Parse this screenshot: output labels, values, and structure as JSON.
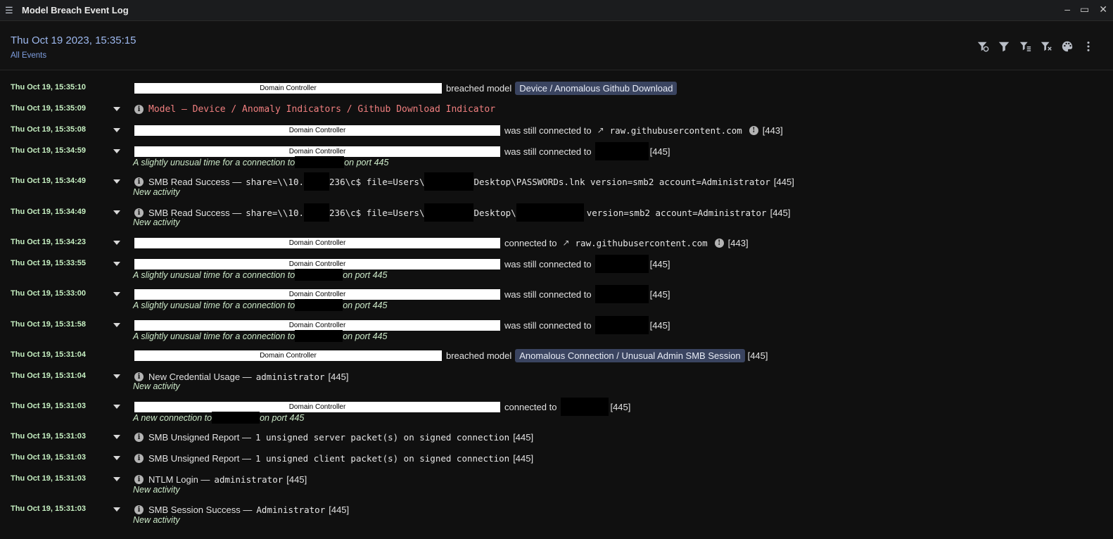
{
  "window": {
    "title": "Model Breach Event Log",
    "menu_icon": "list-icon",
    "controls": {
      "minimize": "–",
      "maximize": "▭",
      "close": "✕"
    }
  },
  "header": {
    "date": "Thu Oct 19 2023, 15:35:15",
    "subtitle": "All Events",
    "tools": [
      "filter-clear-icon",
      "filter-icon",
      "filter-list-icon",
      "filter-off-icon",
      "palette-icon",
      "more-vertical-icon"
    ]
  },
  "redacted_label": "Domain Controller",
  "events": [
    {
      "time": "Thu Oct 19, 15:35:10",
      "action": "breached model",
      "badge": "Device / Anomalous Github Download"
    },
    {
      "time": "Thu Oct 19, 15:35:09",
      "model": "Model — Device / Anomaly Indicators / Github Download Indicator"
    },
    {
      "time": "Thu Oct 19, 15:35:08",
      "action": "was still connected to",
      "host": "raw.githubusercontent.com",
      "port": "[443]"
    },
    {
      "time": "Thu Oct 19, 15:34:59",
      "action": "was still connected to",
      "port": "[445]",
      "note_a": "A slightly unusual time for a connection to",
      "note_b": "on port 445"
    },
    {
      "time": "Thu Oct 19, 15:34:49",
      "label": "SMB Read Success —",
      "detail_a": "share=\\\\10.",
      "detail_b": "236\\c$ file=Users\\",
      "detail_c": "Desktop\\PASSWORDs.lnk version=smb2 account=Administrator",
      "port": "[445]",
      "note": "New activity"
    },
    {
      "time": "Thu Oct 19, 15:34:49",
      "label": "SMB Read Success —",
      "detail_a": "share=\\\\10.",
      "detail_b": "236\\c$ file=Users\\",
      "detail_c": "Desktop\\",
      "detail_d": "version=smb2 account=Administrator",
      "port": "[445]",
      "note": "New activity"
    },
    {
      "time": "Thu Oct 19, 15:34:23",
      "action": "connected to",
      "host": "raw.githubusercontent.com",
      "port": "[443]"
    },
    {
      "time": "Thu Oct 19, 15:33:55",
      "action": "was still connected to",
      "port": "[445]",
      "note_a": "A slightly unusual time for a connection to",
      "note_b": "on port 445"
    },
    {
      "time": "Thu Oct 19, 15:33:00",
      "action": "was still connected to",
      "port": "[445]",
      "note_a": "A slightly unusual time for a connection to",
      "note_b": "on port 445"
    },
    {
      "time": "Thu Oct 19, 15:31:58",
      "action": "was still connected to",
      "port": "[445]",
      "note_a": "A slightly unusual time for a connection to",
      "note_b": "on port 445"
    },
    {
      "time": "Thu Oct 19, 15:31:04",
      "action": "breached model",
      "badge": "Anomalous Connection / Unusual Admin SMB Session",
      "port": "[445]"
    },
    {
      "time": "Thu Oct 19, 15:31:04",
      "label": "New Credential Usage —",
      "detail_a": "administrator",
      "port": "[445]",
      "note": "New activity"
    },
    {
      "time": "Thu Oct 19, 15:31:03",
      "action": "connected to",
      "port": "[445]",
      "note_a": "A new connection to",
      "note_b": "on port 445"
    },
    {
      "time": "Thu Oct 19, 15:31:03",
      "label": "SMB Unsigned Report —",
      "detail_a": "1 unsigned server packet(s) on signed connection",
      "port": "[445]"
    },
    {
      "time": "Thu Oct 19, 15:31:03",
      "label": "SMB Unsigned Report —",
      "detail_a": "1 unsigned client packet(s) on signed connection",
      "port": "[445]"
    },
    {
      "time": "Thu Oct 19, 15:31:03",
      "label": "NTLM Login —",
      "detail_a": "administrator",
      "port": "[445]",
      "note": "New activity"
    },
    {
      "time": "Thu Oct 19, 15:31:03",
      "label": "SMB Session Success —",
      "detail_a": "Administrator",
      "port": "[445]",
      "note": "New activity"
    }
  ]
}
